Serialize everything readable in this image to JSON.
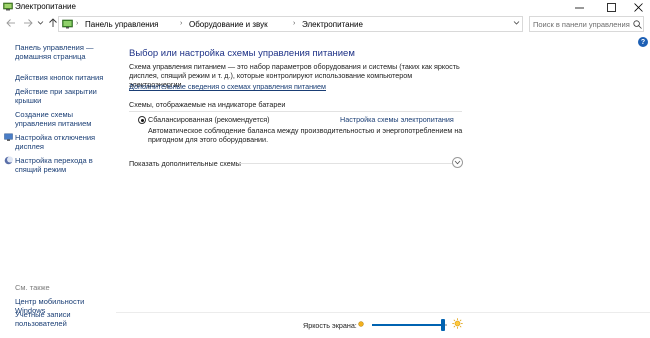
{
  "window": {
    "title": "Электропитание",
    "app_icon": "power-options-icon",
    "controls": {
      "minimize": "minimize-icon",
      "maximize": "maximize-icon",
      "close": "close-icon"
    }
  },
  "navigation": {
    "breadcrumbs": [
      "Панель управления",
      "Оборудование и звук",
      "Электропитание"
    ],
    "search_placeholder": "Поиск в панели управления"
  },
  "sidebar": {
    "items": [
      {
        "label": "Панель управления — домашняя страница"
      },
      {
        "label": "Действия кнопок питания"
      },
      {
        "label": "Действие при закрытии крышки"
      },
      {
        "label": "Создание схемы управления питанием"
      },
      {
        "label": "Настройка отключения дисплея",
        "icon": "display-icon"
      },
      {
        "label": "Настройка перехода в спящий режим",
        "icon": "moon-sleep-icon"
      }
    ],
    "see_also_title": "См. также",
    "see_also": [
      {
        "label": "Центр мобильности Windows"
      },
      {
        "label": "Учетные записи пользователей"
      }
    ]
  },
  "main": {
    "title": "Выбор или настройка схемы управления питанием",
    "description": "Схема управления питанием — это набор параметров оборудования и системы (таких как яркость дисплея, спящий режим и т. д.), которые контролируют использование компьютером электроэнергии.",
    "more_info_link": "Дополнительные сведения о схемах управления питанием",
    "plans_group_title": "Схемы, отображаемые на индикаторе батареи",
    "plans": [
      {
        "name": "Сбалансированная (рекомендуется)",
        "selected": true,
        "settings_link": "Настройка схемы электропитания",
        "description": "Автоматическое соблюдение баланса между производительностью и энергопотреблением на пригодном для этого оборудовании."
      }
    ],
    "show_more_label": "Показать дополнительные схемы"
  },
  "footer": {
    "brightness_label": "Яркость экрана:",
    "brightness_fraction": 0.95
  },
  "colors": {
    "link": "#1a3e75",
    "heading": "#1e3287",
    "accent": "#0063b1"
  }
}
